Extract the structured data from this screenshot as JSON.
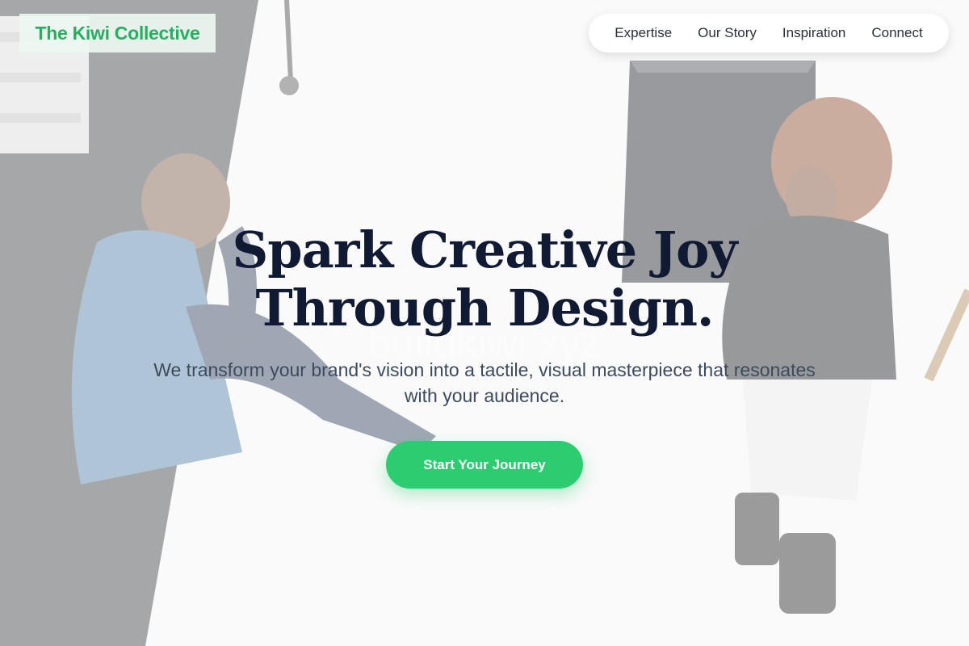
{
  "brand": {
    "name": "The Kiwi Collective",
    "color": "#27ae60"
  },
  "nav": {
    "items": [
      {
        "label": "Expertise"
      },
      {
        "label": "Our Story"
      },
      {
        "label": "Inspiration"
      },
      {
        "label": "Connect"
      }
    ]
  },
  "hero": {
    "headline_line1": "Spark Creative Joy",
    "headline_line2": "Through Design.",
    "subtitle": "We transform your brand's vision into a tactile, visual masterpiece that resonates with your audience.",
    "cta_label": "Start Your Journey",
    "cta_color": "#2ecc71",
    "watermark": "buildkiwi.xyz"
  }
}
